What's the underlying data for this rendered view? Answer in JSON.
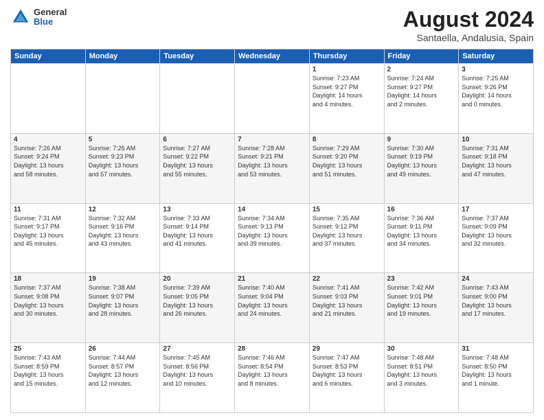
{
  "header": {
    "logo": {
      "general": "General",
      "blue": "Blue"
    },
    "title": "August 2024",
    "location": "Santaella, Andalusia, Spain"
  },
  "weekdays": [
    "Sunday",
    "Monday",
    "Tuesday",
    "Wednesday",
    "Thursday",
    "Friday",
    "Saturday"
  ],
  "weeks": [
    [
      {
        "day": "",
        "info": ""
      },
      {
        "day": "",
        "info": ""
      },
      {
        "day": "",
        "info": ""
      },
      {
        "day": "",
        "info": ""
      },
      {
        "day": "1",
        "info": "Sunrise: 7:23 AM\nSunset: 9:27 PM\nDaylight: 14 hours\nand 4 minutes."
      },
      {
        "day": "2",
        "info": "Sunrise: 7:24 AM\nSunset: 9:27 PM\nDaylight: 14 hours\nand 2 minutes."
      },
      {
        "day": "3",
        "info": "Sunrise: 7:25 AM\nSunset: 9:26 PM\nDaylight: 14 hours\nand 0 minutes."
      }
    ],
    [
      {
        "day": "4",
        "info": "Sunrise: 7:26 AM\nSunset: 9:24 PM\nDaylight: 13 hours\nand 58 minutes."
      },
      {
        "day": "5",
        "info": "Sunrise: 7:26 AM\nSunset: 9:23 PM\nDaylight: 13 hours\nand 57 minutes."
      },
      {
        "day": "6",
        "info": "Sunrise: 7:27 AM\nSunset: 9:22 PM\nDaylight: 13 hours\nand 55 minutes."
      },
      {
        "day": "7",
        "info": "Sunrise: 7:28 AM\nSunset: 9:21 PM\nDaylight: 13 hours\nand 53 minutes."
      },
      {
        "day": "8",
        "info": "Sunrise: 7:29 AM\nSunset: 9:20 PM\nDaylight: 13 hours\nand 51 minutes."
      },
      {
        "day": "9",
        "info": "Sunrise: 7:30 AM\nSunset: 9:19 PM\nDaylight: 13 hours\nand 49 minutes."
      },
      {
        "day": "10",
        "info": "Sunrise: 7:31 AM\nSunset: 9:18 PM\nDaylight: 13 hours\nand 47 minutes."
      }
    ],
    [
      {
        "day": "11",
        "info": "Sunrise: 7:31 AM\nSunset: 9:17 PM\nDaylight: 13 hours\nand 45 minutes."
      },
      {
        "day": "12",
        "info": "Sunrise: 7:32 AM\nSunset: 9:16 PM\nDaylight: 13 hours\nand 43 minutes."
      },
      {
        "day": "13",
        "info": "Sunrise: 7:33 AM\nSunset: 9:14 PM\nDaylight: 13 hours\nand 41 minutes."
      },
      {
        "day": "14",
        "info": "Sunrise: 7:34 AM\nSunset: 9:13 PM\nDaylight: 13 hours\nand 39 minutes."
      },
      {
        "day": "15",
        "info": "Sunrise: 7:35 AM\nSunset: 9:12 PM\nDaylight: 13 hours\nand 37 minutes."
      },
      {
        "day": "16",
        "info": "Sunrise: 7:36 AM\nSunset: 9:11 PM\nDaylight: 13 hours\nand 34 minutes."
      },
      {
        "day": "17",
        "info": "Sunrise: 7:37 AM\nSunset: 9:09 PM\nDaylight: 13 hours\nand 32 minutes."
      }
    ],
    [
      {
        "day": "18",
        "info": "Sunrise: 7:37 AM\nSunset: 9:08 PM\nDaylight: 13 hours\nand 30 minutes."
      },
      {
        "day": "19",
        "info": "Sunrise: 7:38 AM\nSunset: 9:07 PM\nDaylight: 13 hours\nand 28 minutes."
      },
      {
        "day": "20",
        "info": "Sunrise: 7:39 AM\nSunset: 9:05 PM\nDaylight: 13 hours\nand 26 minutes."
      },
      {
        "day": "21",
        "info": "Sunrise: 7:40 AM\nSunset: 9:04 PM\nDaylight: 13 hours\nand 24 minutes."
      },
      {
        "day": "22",
        "info": "Sunrise: 7:41 AM\nSunset: 9:03 PM\nDaylight: 13 hours\nand 21 minutes."
      },
      {
        "day": "23",
        "info": "Sunrise: 7:42 AM\nSunset: 9:01 PM\nDaylight: 13 hours\nand 19 minutes."
      },
      {
        "day": "24",
        "info": "Sunrise: 7:43 AM\nSunset: 9:00 PM\nDaylight: 13 hours\nand 17 minutes."
      }
    ],
    [
      {
        "day": "25",
        "info": "Sunrise: 7:43 AM\nSunset: 8:59 PM\nDaylight: 13 hours\nand 15 minutes."
      },
      {
        "day": "26",
        "info": "Sunrise: 7:44 AM\nSunset: 8:57 PM\nDaylight: 13 hours\nand 12 minutes."
      },
      {
        "day": "27",
        "info": "Sunrise: 7:45 AM\nSunset: 8:56 PM\nDaylight: 13 hours\nand 10 minutes."
      },
      {
        "day": "28",
        "info": "Sunrise: 7:46 AM\nSunset: 8:54 PM\nDaylight: 13 hours\nand 8 minutes."
      },
      {
        "day": "29",
        "info": "Sunrise: 7:47 AM\nSunset: 8:53 PM\nDaylight: 13 hours\nand 6 minutes."
      },
      {
        "day": "30",
        "info": "Sunrise: 7:48 AM\nSunset: 8:51 PM\nDaylight: 13 hours\nand 3 minutes."
      },
      {
        "day": "31",
        "info": "Sunrise: 7:48 AM\nSunset: 8:50 PM\nDaylight: 13 hours\nand 1 minute."
      }
    ]
  ],
  "colors": {
    "header_bg": "#1a5fb4",
    "row_odd": "#ffffff",
    "row_even": "#f0f0f0"
  }
}
